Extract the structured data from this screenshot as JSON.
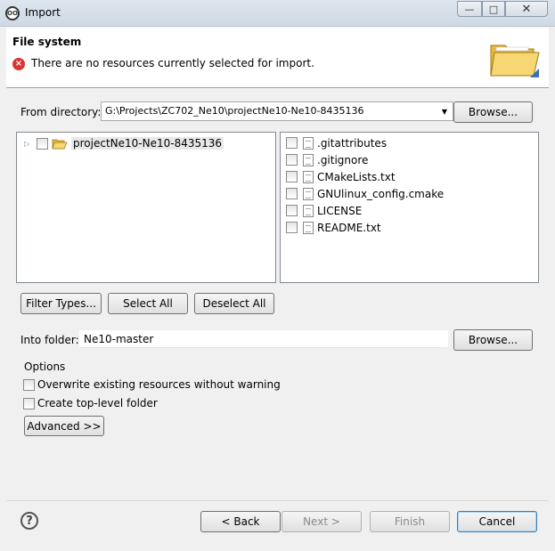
{
  "window": {
    "title": "Import",
    "icon_text": "OO",
    "min_glyph": "—",
    "max_glyph": "□",
    "close_glyph": "✕"
  },
  "header": {
    "title": "File system",
    "message": "There are no resources currently selected for import.",
    "error_glyph": "×"
  },
  "from_directory": {
    "label": "From directory:",
    "value": "G:\\Projects\\ZC702_Ne10\\projectNe10-Ne10-8435136",
    "arrow_glyph": "▼",
    "browse_label": "Browse..."
  },
  "tree": {
    "expander_glyph": "▷",
    "root_label": "projectNe10-Ne10-8435136"
  },
  "files": [
    ".gitattributes",
    ".gitignore",
    "CMakeLists.txt",
    "GNUlinux_config.cmake",
    "LICENSE",
    "README.txt"
  ],
  "buttons": {
    "filter_types": "Filter Types...",
    "select_all": "Select All",
    "deselect_all": "Deselect All"
  },
  "into_folder": {
    "label": "Into folder:",
    "value": "Ne10-master",
    "browse_label": "Browse..."
  },
  "options": {
    "title": "Options",
    "overwrite": "Overwrite existing resources without warning",
    "create_top_level": "Create top-level folder",
    "advanced": "Advanced >>"
  },
  "footer": {
    "help_glyph": "?",
    "back": "< Back",
    "next": "Next >",
    "finish": "Finish",
    "cancel": "Cancel"
  },
  "colors": {
    "error": "#dd3333",
    "folder": "#f2c94c",
    "default_button_border": "#3c7fb1"
  }
}
